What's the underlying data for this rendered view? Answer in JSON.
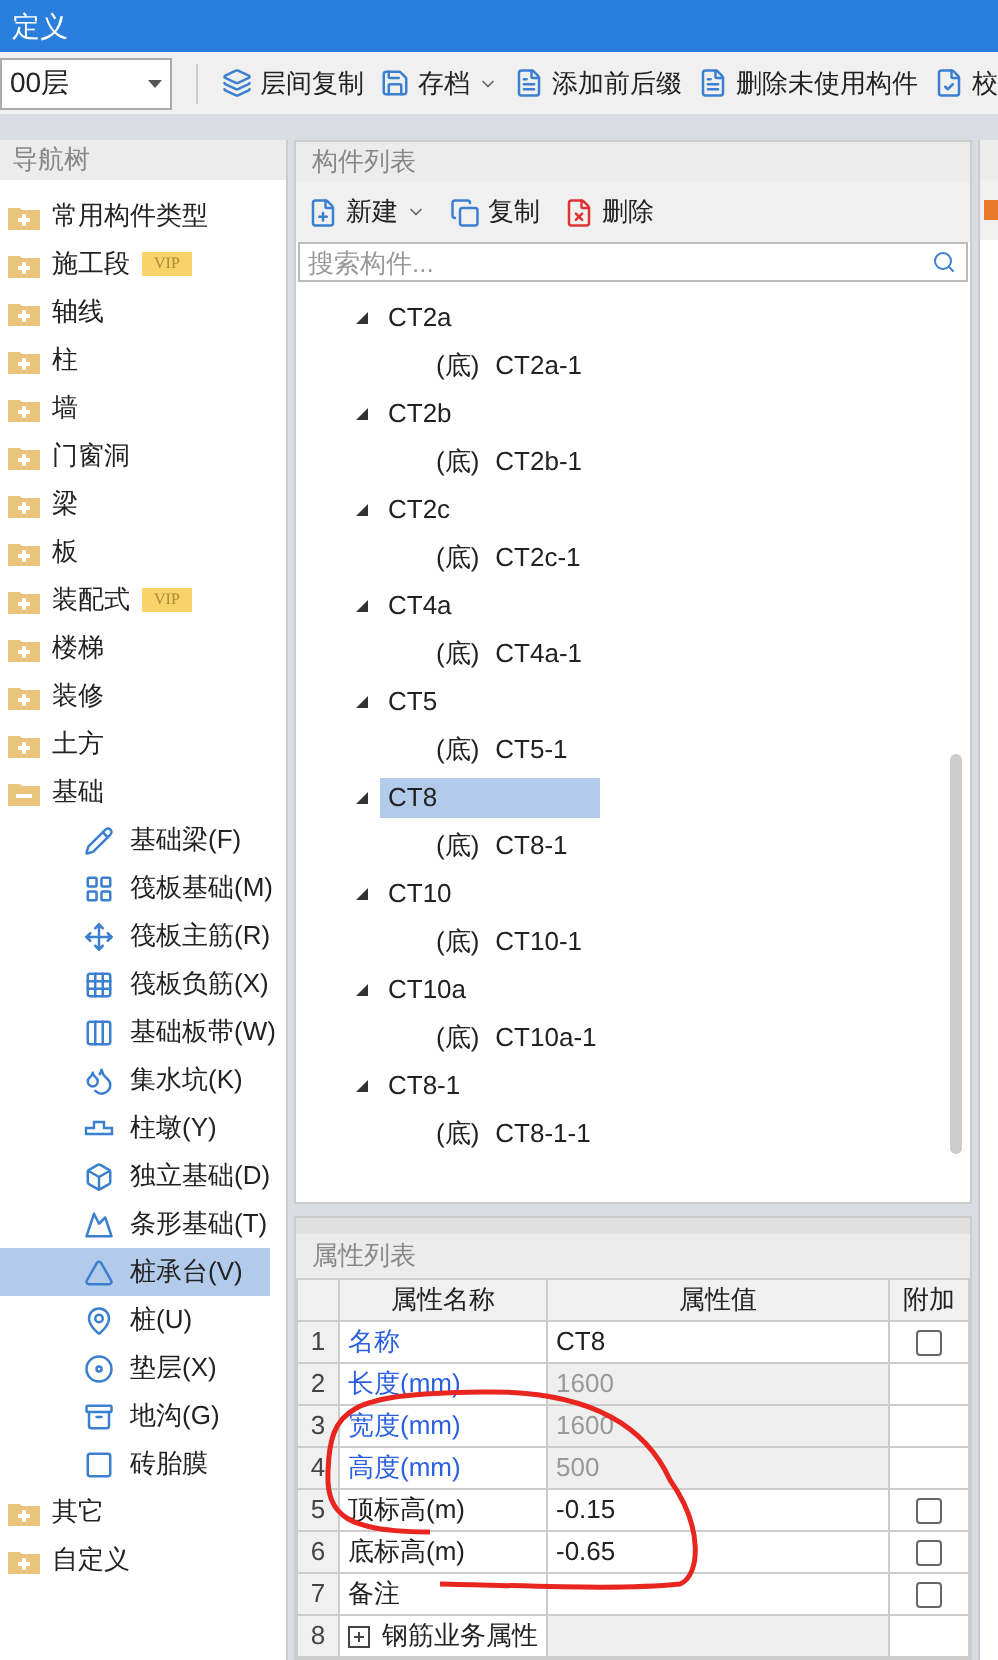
{
  "window": {
    "title": "定义"
  },
  "toolbar": {
    "floor": "00层",
    "buttons": [
      {
        "label": "层间复制",
        "dropdown": false
      },
      {
        "label": "存档",
        "dropdown": true
      },
      {
        "label": "添加前后缀",
        "dropdown": false
      },
      {
        "label": "删除未使用构件",
        "dropdown": false
      },
      {
        "label": "校",
        "dropdown": false
      }
    ]
  },
  "nav_tree": {
    "title": "导航树",
    "items": [
      {
        "label": "常用构件类型",
        "expanded": false,
        "selected": false
      },
      {
        "label": "施工段",
        "badge": "VIP",
        "expanded": false,
        "selected": false
      },
      {
        "label": "轴线",
        "expanded": false,
        "selected": false
      },
      {
        "label": "柱",
        "expanded": false,
        "selected": false
      },
      {
        "label": "墙",
        "expanded": false,
        "selected": false
      },
      {
        "label": "门窗洞",
        "expanded": false,
        "selected": false
      },
      {
        "label": "梁",
        "expanded": false,
        "selected": false
      },
      {
        "label": "板",
        "expanded": false,
        "selected": false
      },
      {
        "label": "装配式",
        "badge": "VIP",
        "expanded": false,
        "selected": false
      },
      {
        "label": "楼梯",
        "expanded": false,
        "selected": false
      },
      {
        "label": "装修",
        "expanded": false,
        "selected": false
      },
      {
        "label": "土方",
        "expanded": false,
        "selected": false
      },
      {
        "label": "基础",
        "expanded": true,
        "selected": false,
        "children": [
          {
            "label": "基础梁(F)",
            "selected": false
          },
          {
            "label": "筏板基础(M)",
            "selected": false
          },
          {
            "label": "筏板主筋(R)",
            "selected": false
          },
          {
            "label": "筏板负筋(X)",
            "selected": false
          },
          {
            "label": "基础板带(W)",
            "selected": false
          },
          {
            "label": "集水坑(K)",
            "selected": false
          },
          {
            "label": "柱墩(Y)",
            "selected": false
          },
          {
            "label": "独立基础(D)",
            "selected": false
          },
          {
            "label": "条形基础(T)",
            "selected": false
          },
          {
            "label": "桩承台(V)",
            "selected": true
          },
          {
            "label": "桩(U)",
            "selected": false
          },
          {
            "label": "垫层(X)",
            "selected": false
          },
          {
            "label": "地沟(G)",
            "selected": false
          },
          {
            "label": "砖胎膜",
            "selected": false
          }
        ]
      },
      {
        "label": "其它",
        "expanded": false,
        "selected": false
      },
      {
        "label": "自定义",
        "expanded": false,
        "selected": false
      }
    ]
  },
  "component_list": {
    "title": "构件列表",
    "buttons": [
      {
        "label": "新建",
        "dropdown": true
      },
      {
        "label": "复制",
        "dropdown": false
      },
      {
        "label": "删除",
        "dropdown": false
      }
    ],
    "search": {
      "placeholder": "搜索构件..."
    },
    "items": [
      {
        "label": "CT2a",
        "expanded": true,
        "selected": false,
        "children": [
          {
            "prefix": "(底)",
            "label": "CT2a-1"
          }
        ]
      },
      {
        "label": "CT2b",
        "expanded": true,
        "selected": false,
        "children": [
          {
            "prefix": "(底)",
            "label": "CT2b-1"
          }
        ]
      },
      {
        "label": "CT2c",
        "expanded": true,
        "selected": false,
        "children": [
          {
            "prefix": "(底)",
            "label": "CT2c-1"
          }
        ]
      },
      {
        "label": "CT4a",
        "expanded": true,
        "selected": false,
        "children": [
          {
            "prefix": "(底)",
            "label": "CT4a-1"
          }
        ]
      },
      {
        "label": "CT5",
        "expanded": true,
        "selected": false,
        "children": [
          {
            "prefix": "(底)",
            "label": "CT5-1"
          }
        ]
      },
      {
        "label": "CT8",
        "expanded": true,
        "selected": true,
        "children": [
          {
            "prefix": "(底)",
            "label": "CT8-1"
          }
        ]
      },
      {
        "label": "CT10",
        "expanded": true,
        "selected": false,
        "children": [
          {
            "prefix": "(底)",
            "label": "CT10-1"
          }
        ]
      },
      {
        "label": "CT10a",
        "expanded": true,
        "selected": false,
        "children": [
          {
            "prefix": "(底)",
            "label": "CT10a-1"
          }
        ]
      },
      {
        "label": "CT8-1",
        "expanded": true,
        "selected": false,
        "children": [
          {
            "prefix": "(底)",
            "label": "CT8-1-1"
          }
        ]
      }
    ]
  },
  "property_list": {
    "title": "属性列表",
    "columns": [
      "属性名称",
      "属性值",
      "附加"
    ],
    "rows": [
      {
        "number": "1",
        "name": "名称",
        "value": "CT8",
        "kind": "link",
        "readonly": false,
        "checked": false
      },
      {
        "number": "2",
        "name": "长度(mm)",
        "value": "1600",
        "kind": "link",
        "readonly": true
      },
      {
        "number": "3",
        "name": "宽度(mm)",
        "value": "1600",
        "kind": "link",
        "readonly": true
      },
      {
        "number": "4",
        "name": "高度(mm)",
        "value": "500",
        "kind": "link",
        "readonly": true
      },
      {
        "number": "5",
        "name": "顶标高(m)",
        "value": "-0.15",
        "kind": "plain",
        "readonly": false,
        "checked": false
      },
      {
        "number": "6",
        "name": "底标高(m)",
        "value": "-0.65",
        "kind": "plain",
        "readonly": false,
        "checked": false
      },
      {
        "number": "7",
        "name": "备注",
        "kind": "plain",
        "readonly": false,
        "checked": false
      },
      {
        "number": "8",
        "name": "钢筋业务属性",
        "kind": "group",
        "readonly": true,
        "expanded": false
      }
    ]
  }
}
